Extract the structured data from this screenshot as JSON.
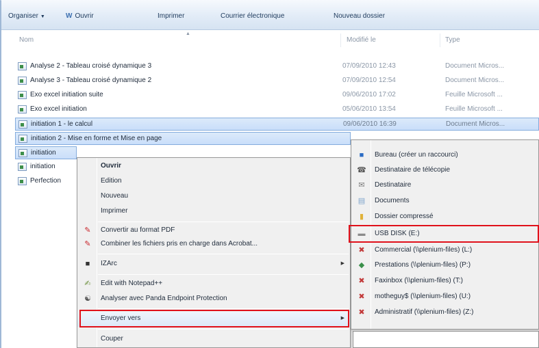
{
  "toolbar": {
    "organize": "Organiser",
    "open": "Ouvrir",
    "open_icon": "W",
    "print": "Imprimer",
    "email": "Courrier électronique",
    "new_folder": "Nouveau dossier"
  },
  "columns": {
    "name": "Nom",
    "modified": "Modifié le",
    "type": "Type"
  },
  "files": [
    {
      "name": "Analyse 2 - Tableau croisé dynamique 3",
      "date": "07/09/2010 12:43",
      "type": "Document Micros..."
    },
    {
      "name": "Analyse 3 - Tableau croisé dynamique 2",
      "date": "07/09/2010 12:54",
      "type": "Document Micros..."
    },
    {
      "name": "Exo excel initiation suite",
      "date": "09/06/2010 17:02",
      "type": "Feuille Microsoft ..."
    },
    {
      "name": "Exo excel initiation",
      "date": "05/06/2010 13:54",
      "type": "Feuille Microsoft ..."
    },
    {
      "name": "initiation 1 - le calcul",
      "date": "09/06/2010 16:39",
      "type": "Document Micros..."
    },
    {
      "name": "initiation 2 - Mise en forme et Mise en page",
      "date": "",
      "type": ""
    },
    {
      "name": "initiation",
      "date": "",
      "type": ""
    },
    {
      "name": "initiation",
      "date": "",
      "type": ""
    },
    {
      "name": "Perfection",
      "date": "",
      "type": ""
    }
  ],
  "context_menu": {
    "open": "Ouvrir",
    "edit": "Edition",
    "new": "Nouveau",
    "print": "Imprimer",
    "convert_pdf": "Convertir au format PDF",
    "combine_acrobat": "Combiner les fichiers pris en charge dans Acrobat...",
    "izarc": "IZArc",
    "notepad": "Edit with Notepad++",
    "panda": "Analyser avec Panda Endpoint Protection",
    "send_to": "Envoyer vers",
    "cut": "Couper"
  },
  "send_to_menu": [
    {
      "label": "Bureau (créer un raccourci)",
      "icon": "desktop-icon"
    },
    {
      "label": "Destinataire de télécopie",
      "icon": "fax-icon"
    },
    {
      "label": "Destinataire",
      "icon": "mail-recipient-icon"
    },
    {
      "label": "Documents",
      "icon": "documents-icon"
    },
    {
      "label": "Dossier compressé",
      "icon": "zip-folder-icon"
    },
    {
      "label": "USB DISK (E:)",
      "icon": "usb-drive-icon"
    },
    {
      "label": "Commercial (\\\\plenium-files) (L:)",
      "icon": "network-drive-icon"
    },
    {
      "label": "Prestations (\\\\plenium-files) (P:)",
      "icon": "network-drive-icon"
    },
    {
      "label": "Faxinbox (\\\\plenium-files) (T:)",
      "icon": "network-drive-icon"
    },
    {
      "label": "motheguy$ (\\\\plenium-files) (U:)",
      "icon": "network-drive-icon"
    },
    {
      "label": "Administratif (\\\\plenium-files) (Z:)",
      "icon": "network-drive-icon"
    }
  ],
  "colors": {
    "highlight_red": "#e0101a",
    "selection_blue": "#c9defa",
    "toolbar_blue": "#dce8f5"
  }
}
